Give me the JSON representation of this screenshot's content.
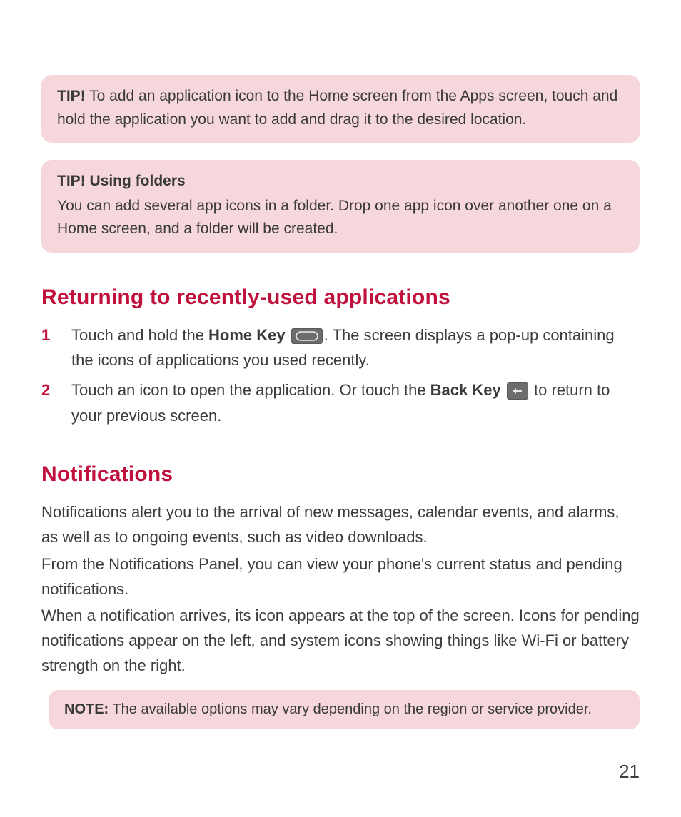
{
  "tip1": {
    "prefix": "TIP!",
    "text": "To add an application icon to the Home screen from the Apps screen, touch and hold the application you want to add and drag it to the desired location."
  },
  "tip2": {
    "title": "TIP! Using folders",
    "text": "You can add several app icons in a folder. Drop one app icon over another one on a Home screen, and a folder will be created."
  },
  "section1": {
    "heading": "Returning to recently-used applications",
    "step1_a": "Touch and hold the ",
    "step1_home_key": "Home Key",
    "step1_b": ". The screen displays a pop-up containing the icons of applications you used recently.",
    "step2_a": "Touch an icon to open the application. Or touch the ",
    "step2_back_key": "Back Key",
    "step2_b": " to return to your previous screen."
  },
  "section2": {
    "heading": "Notifications",
    "p1": "Notifications alert you to the arrival of new messages, calendar events, and alarms, as well as to ongoing events, such as video downloads.",
    "p2": "From the Notifications Panel, you can view your phone's current status and pending notifications.",
    "p3": "When a notification arrives, its icon appears at the top of the screen. Icons for pending notifications appear on the left, and system icons showing things like Wi-Fi or battery strength on the right."
  },
  "note": {
    "prefix": "NOTE:",
    "text": "The available options may vary depending on the region or service provider."
  },
  "page_number": "21",
  "icons": {
    "home_key": "home-key-icon",
    "back_key": "back-key-icon"
  },
  "colors": {
    "accent": "#c0113c",
    "tip_bg": "#f6d7db",
    "text": "#3c3c3c"
  }
}
